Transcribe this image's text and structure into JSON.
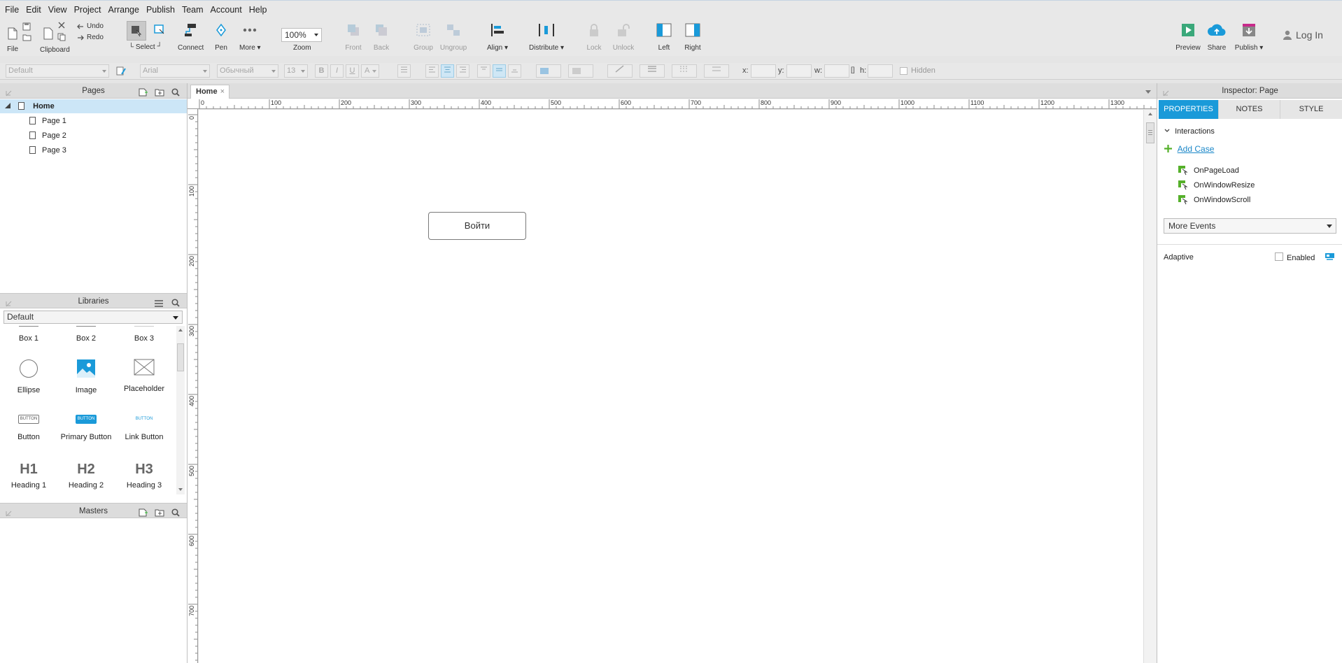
{
  "menubar": {
    "items": [
      "File",
      "Edit",
      "View",
      "Project",
      "Arrange",
      "Publish",
      "Team",
      "Account",
      "Help"
    ]
  },
  "toolbar": {
    "file_label": "File",
    "clipboard_label": "Clipboard",
    "undo_label": "Undo",
    "redo_label": "Redo",
    "select_label": "Select",
    "connect_label": "Connect",
    "pen_label": "Pen",
    "more_label": "More ▾",
    "zoom_value": "100%",
    "zoom_label": "Zoom",
    "front_label": "Front",
    "back_label": "Back",
    "group_label": "Group",
    "ungroup_label": "Ungroup",
    "align_label": "Align ▾",
    "distribute_label": "Distribute ▾",
    "lock_label": "Lock",
    "unlock_label": "Unlock",
    "left_label": "Left",
    "right_label": "Right",
    "preview_label": "Preview",
    "share_label": "Share",
    "publish_label": "Publish ▾",
    "login_label": "Log In",
    "accent_color": "#1a9ad9"
  },
  "formatbar": {
    "style_value": "Default",
    "font_value": "Arial",
    "weight_value": "Обычный",
    "size_value": "13",
    "bold": "B",
    "italic": "I",
    "underline": "U",
    "font_color": "A",
    "x_label": "x:",
    "y_label": "y:",
    "w_label": "w:",
    "h_label": "h:",
    "hidden_label": "Hidden"
  },
  "pages_panel": {
    "title": "Pages",
    "root": "Home",
    "pages": [
      "Page 1",
      "Page 2",
      "Page 3"
    ]
  },
  "libraries_panel": {
    "title": "Libraries",
    "selected_library": "Default",
    "items": [
      {
        "label": "Box 1",
        "icon": "box-icon"
      },
      {
        "label": "Box 2",
        "icon": "box-icon"
      },
      {
        "label": "Box 3",
        "icon": "box-icon"
      },
      {
        "label": "Ellipse",
        "icon": "ellipse-icon"
      },
      {
        "label": "Image",
        "icon": "image-icon"
      },
      {
        "label": "Placeholder",
        "icon": "placeholder-icon"
      },
      {
        "label": "Button",
        "icon": "button-icon",
        "text": "BUTTON"
      },
      {
        "label": "Primary Button",
        "icon": "primary-button-icon",
        "text": "BUTTON"
      },
      {
        "label": "Link Button",
        "icon": "link-button-icon",
        "text": "BUTTON"
      },
      {
        "label": "Heading 1",
        "icon": "heading-icon",
        "text": "H1"
      },
      {
        "label": "Heading 2",
        "icon": "heading-icon",
        "text": "H2"
      },
      {
        "label": "Heading 3",
        "icon": "heading-icon",
        "text": "H3"
      }
    ]
  },
  "masters_panel": {
    "title": "Masters"
  },
  "canvas": {
    "active_tab": "Home",
    "hruler_labels": [
      "0",
      "100",
      "200",
      "300",
      "400",
      "500",
      "600",
      "700",
      "800",
      "900",
      "1000",
      "1100",
      "1200",
      "1300"
    ],
    "vruler_labels": [
      "0",
      "100",
      "200",
      "300",
      "400",
      "500",
      "600",
      "700"
    ],
    "widget_button_text": "Войти"
  },
  "inspector": {
    "title": "Inspector: Page",
    "tabs": [
      "PROPERTIES",
      "NOTES",
      "STYLE"
    ],
    "active_tab": "PROPERTIES",
    "interactions_label": "Interactions",
    "add_case_label": "Add Case",
    "events": [
      "OnPageLoad",
      "OnWindowResize",
      "OnWindowScroll"
    ],
    "more_events_label": "More Events",
    "adaptive_label": "Adaptive",
    "enabled_label": "Enabled"
  }
}
